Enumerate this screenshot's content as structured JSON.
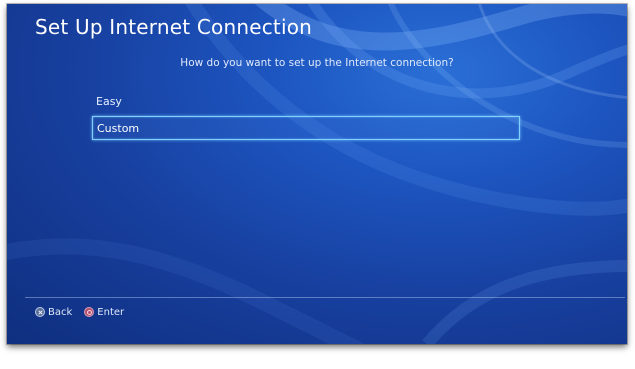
{
  "window": {
    "title": "Set Up Internet Connection"
  },
  "prompt": {
    "question": "How do you want to set up the Internet connection?"
  },
  "options": [
    {
      "label": "Easy",
      "selected": false
    },
    {
      "label": "Custom",
      "selected": true
    }
  ],
  "footer": {
    "back": {
      "icon": "cross-button-icon",
      "label": "Back"
    },
    "enter": {
      "icon": "circle-button-icon",
      "label": "Enter"
    }
  },
  "colors": {
    "background": "#1d55c0",
    "focus_border": "#7fd1ff",
    "text": "#ffffff"
  }
}
